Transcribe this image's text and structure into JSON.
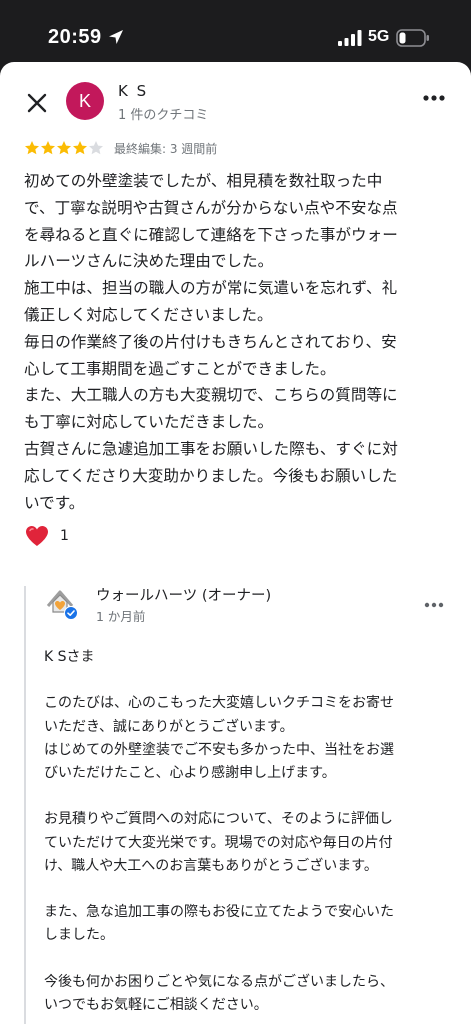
{
  "status_bar": {
    "time": "20:59",
    "network": "5G",
    "icons": [
      "location-arrow-icon",
      "signal-bars-icon",
      "battery-icon"
    ]
  },
  "review": {
    "reviewer_initial": "K",
    "reviewer_name": "K S",
    "reviewer_meta": "1 件のクチコミ",
    "rating": 4,
    "rating_max": 5,
    "edited": "最終編集: 3 週間前",
    "text": "初めての外壁塗装でしたが、相見積を数社取った中\nで、丁寧な説明や古賀さんが分からない点や不安な点\nを尋ねると直ぐに確認して連絡を下さった事がウォー\nルハーツさんに決めた理由でした。\n施工中は、担当の職人の方が常に気遣いを忘れず、礼\n儀正しく対応してくださいました。\n毎日の作業終了後の片付けもきちんとされており、安\n心して工事期間を過ごすことができました。\nまた、大工職人の方も大変親切で、こちらの質問等に\nも丁寧に対応していただきました。\n古賀さんに急遽追加工事をお願いした際も、すぐに対\n応してくださり大変助かりました。今後もお願いした\nいです。",
    "reaction_icon": "heart-icon",
    "reaction_count": "1",
    "accent_color": "#c2185b",
    "star_color": "#fbbc04"
  },
  "owner_reply": {
    "name": "ウォールハーツ (オーナー)",
    "meta": "1 か月前",
    "text": "K Sさま\n\nこのたびは、心のこもった大変嬉しいクチコミをお寄せ\nいただき、誠にありがとうございます。\nはじめての外壁塗装でご不安も多かった中、当社をお選\nびいただけたこと、心より感謝申し上げます。\n\nお見積りやご質問への対応について、そのように評価し\nていただけて大変光栄です。現場での対応や毎日の片付\nけ、職人や大工へのお言葉もありがとうございます。\n\nまた、急な追加工事の際もお役に立てたようで安心いた\nしました。\n\n今後も何かお困りごとや気になる点がございましたら、\nいつでもお気軽にご相談ください。"
  }
}
